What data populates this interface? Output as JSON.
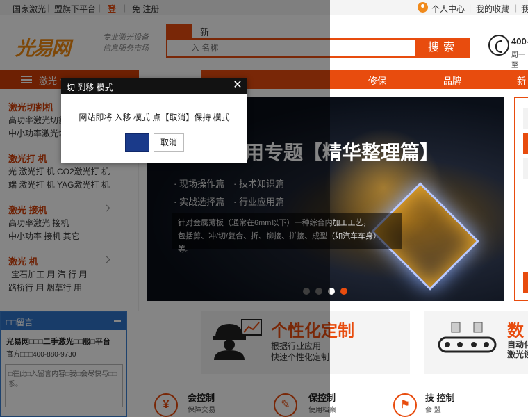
{
  "topbar": {
    "link1": "国家激光",
    "link2": "盟旗下平台",
    "login": "登",
    "register": "免 注册",
    "user_center": "个人中心",
    "favorites": "我的收藏",
    "more": "我"
  },
  "header": {
    "logo": "光易网",
    "slogan_line1": "专业激光设备",
    "slogan_line2": "信息服务市场",
    "search_tab": "新",
    "search_placeholder": "入 名称",
    "search_button": "搜索",
    "phone": "400-",
    "phone_sub": "周一至"
  },
  "nav": {
    "category_label": "激光 ∨",
    "items": [
      "修保",
      "品牌",
      "新"
    ]
  },
  "sidebar": {
    "categories": [
      {
        "title": "激光切割机",
        "lines": [
          "高功率激光切割",
          "中小功率激光切"
        ]
      },
      {
        "title": "激光打 机",
        "lines": [
          "光 激光打 机   CO2激光打 机",
          "端 激光打 机   YAG激光打 机"
        ]
      },
      {
        "title": "激光 接机",
        "lines": [
          "高功率激光 接机",
          "中小功率 接机   其它"
        ]
      },
      {
        "title": "激光 机",
        "lines": [
          "宝石加工  用      汽 行  用",
          "路桥行  用      烟草行  用"
        ]
      }
    ]
  },
  "banner": {
    "title": "用专题【精华整理篇】",
    "links": [
      "现场操作篇",
      "技术知识篇",
      "实战选择篇",
      "行业应用篇"
    ],
    "desc_line1": "针对金属薄板（通常在6mm以下）一种综合内加工工艺，",
    "desc_line2": "包括剪、冲/切/复合、折、铆接、拼接、成型（如汽车车身）等。",
    "slides": 4,
    "current_slide": 3
  },
  "features": [
    {
      "title": "个性化定制",
      "sub1": "根据行业应用",
      "sub2": "快速个性化定制"
    },
    {
      "title": "数",
      "sub1": "自动化",
      "sub2": "激光设"
    }
  ],
  "services": [
    {
      "icon": "¥",
      "title": "会控制",
      "sub": "保障交易"
    },
    {
      "icon": "✎",
      "title": "保控制",
      "sub": "使用档案"
    },
    {
      "icon": "⚑",
      "title": "技 控制",
      "sub": "会 盟"
    }
  ],
  "chat": {
    "title": "□□留言",
    "company": "光易网□□□二手激光□□服□平台",
    "tel": "官方□□□400-880-9730",
    "placeholder": "□在此□入留言内容□我□会尽快与□□系。"
  },
  "dialog": {
    "title": "切 到移 模式",
    "message": "网站即将 入移 模式 点【取消】保持   模式",
    "ok_label": "",
    "cancel_label": "取消"
  }
}
